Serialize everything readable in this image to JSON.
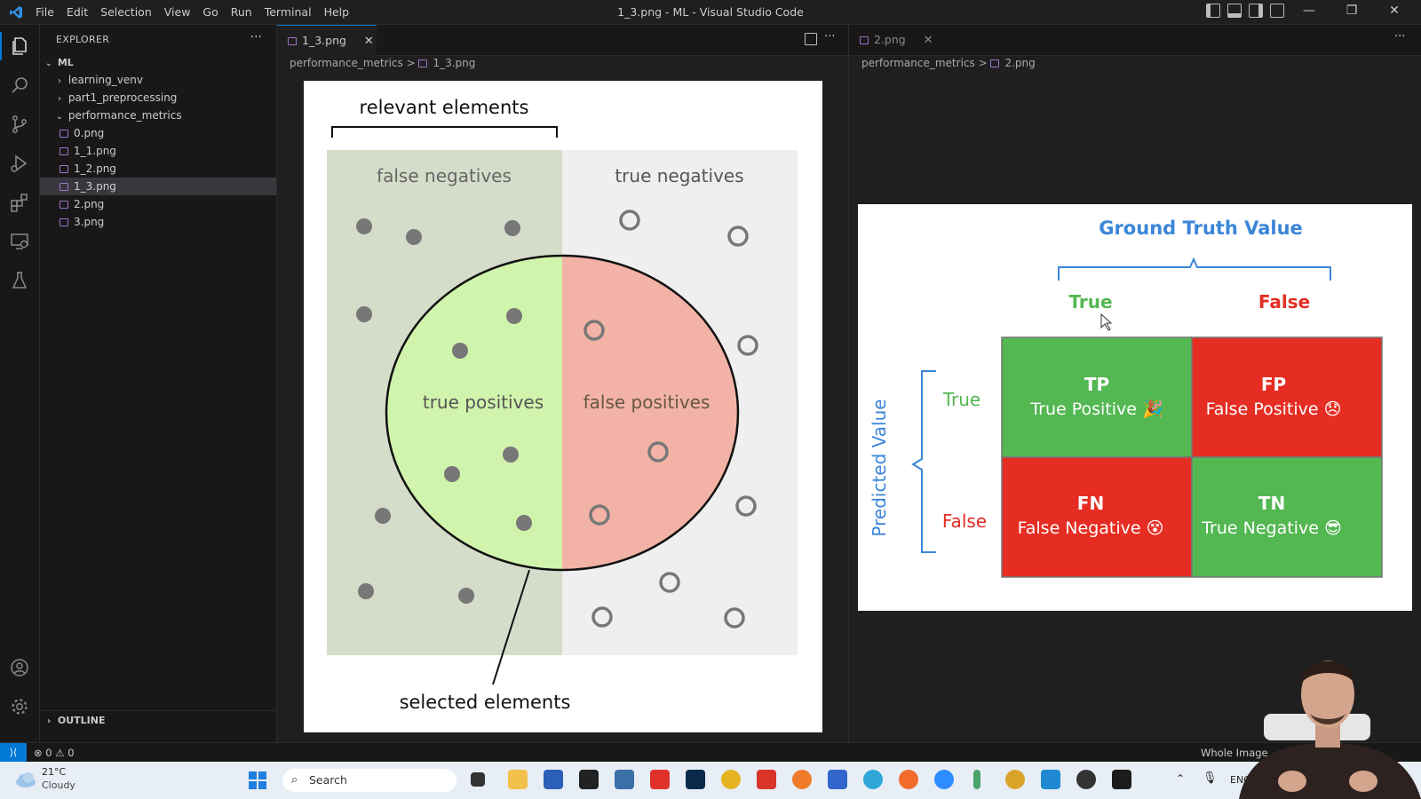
{
  "titlebar": {
    "menu": [
      "File",
      "Edit",
      "Selection",
      "View",
      "Go",
      "Run",
      "Terminal",
      "Help"
    ],
    "title": "1_3.png - ML - Visual Studio Code",
    "controls": [
      "—",
      "❐",
      "✕"
    ]
  },
  "sidebar": {
    "header": "EXPLORER",
    "more": "···",
    "root": "ML",
    "items": [
      {
        "label": "learning_venv",
        "type": "folder",
        "expanded": false
      },
      {
        "label": "part1_preprocessing",
        "type": "folder",
        "expanded": false
      },
      {
        "label": "performance_metrics",
        "type": "folder",
        "expanded": true
      },
      {
        "label": "0.png",
        "type": "file"
      },
      {
        "label": "1_1.png",
        "type": "file"
      },
      {
        "label": "1_2.png",
        "type": "file"
      },
      {
        "label": "1_3.png",
        "type": "file",
        "selected": true
      },
      {
        "label": "2.png",
        "type": "file"
      },
      {
        "label": "3.png",
        "type": "file"
      }
    ],
    "outline": "OUTLINE"
  },
  "editor1": {
    "tab": "1_3.png",
    "close": "✕",
    "breadcrumb_folder": "performance_metrics",
    "breadcrumb_file": "1_3.png",
    "sep": ">",
    "actions_more": "···",
    "diagram": {
      "relevant": "relevant elements",
      "false_negatives": "false negatives",
      "true_negatives": "true negatives",
      "true_positives": "true positives",
      "false_positives": "false positives",
      "selected": "selected elements"
    }
  },
  "editor2": {
    "tab": "2.png",
    "close": "✕",
    "breadcrumb_folder": "performance_metrics",
    "breadcrumb_file": "2.png",
    "sep": ">",
    "actions_more": "···",
    "matrix": {
      "ground_truth": "Ground Truth Value",
      "predicted": "Predicted  Value",
      "col_true": "True",
      "col_false": "False",
      "row_true": "True",
      "row_false": "False",
      "tp_abbr": "TP",
      "tp_full": "True Positive 🎉",
      "fp_abbr": "FP",
      "fp_full": "False Positive 😞",
      "fn_abbr": "FN",
      "fn_full": "False Negative 😵",
      "tn_abbr": "TN",
      "tn_full": "True Negative 😎",
      "colors": {
        "green": "#53b752",
        "red": "#e52d23",
        "blue": "#3b86d9"
      }
    }
  },
  "statusbar": {
    "errors": "0",
    "warnings": "0",
    "right": "Whole Image"
  },
  "taskbar": {
    "temp": "21°C",
    "weather": "Cloudy",
    "search": "Search",
    "lang": "ENG"
  }
}
